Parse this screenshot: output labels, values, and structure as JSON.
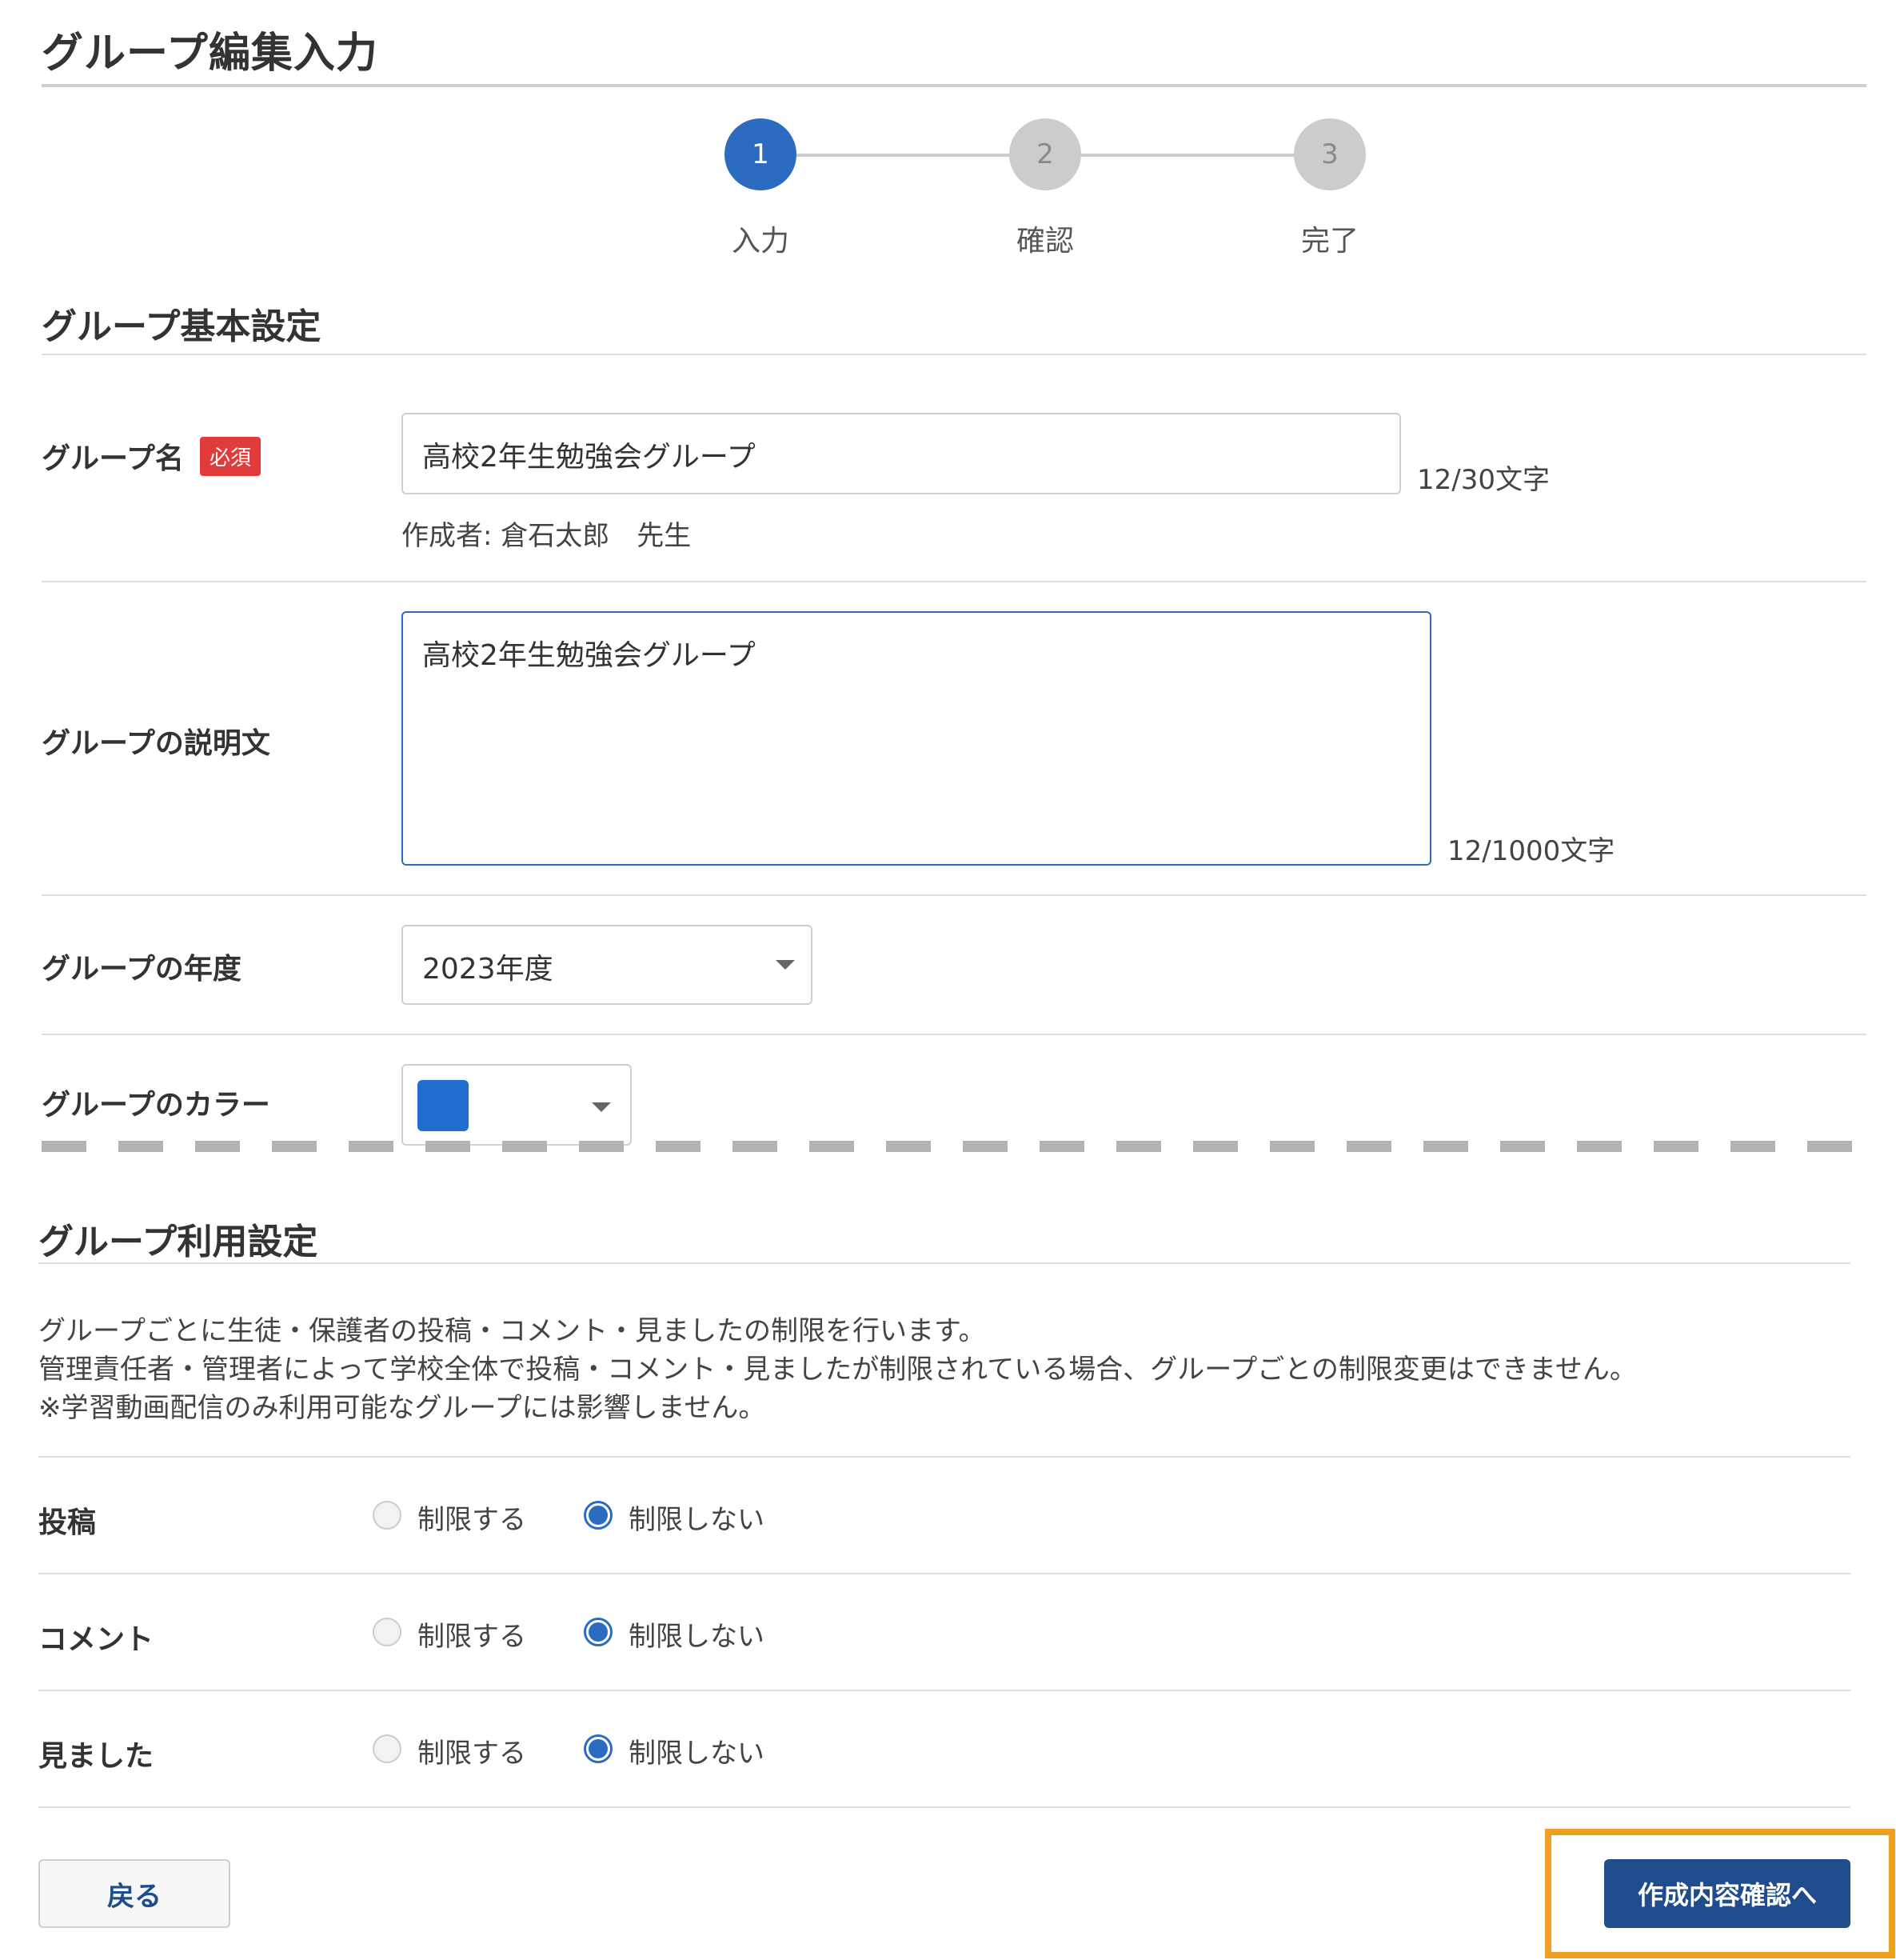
{
  "page": {
    "title": "グループ編集入力"
  },
  "stepper": {
    "steps": [
      {
        "number": "1",
        "label": "入力",
        "state": "active"
      },
      {
        "number": "2",
        "label": "確認",
        "state": "inactive"
      },
      {
        "number": "3",
        "label": "完了",
        "state": "inactive"
      }
    ]
  },
  "basic": {
    "section_title": "グループ基本設定",
    "name": {
      "label": "グループ名",
      "required_badge": "必須",
      "value": "高校2年生勉強会グループ",
      "counter": "12/30文字",
      "creator": "作成者: 倉石太郎　先生"
    },
    "description": {
      "label": "グループの説明文",
      "value": "高校2年生勉強会グループ",
      "counter": "12/1000文字"
    },
    "year": {
      "label": "グループの年度",
      "selected": "2023年度"
    },
    "color": {
      "label": "グループのカラー",
      "selected_color": "#1f6fd0"
    }
  },
  "usage": {
    "section_title": "グループ利用設定",
    "description_lines": [
      "グループごとに生徒・保護者の投稿・コメント・見ましたの制限を行います。",
      "管理責任者・管理者によって学校全体で投稿・コメント・見ましたが制限されている場合、グループごとの制限変更はできません。",
      "※学習動画配信のみ利用可能なグループには影響しません。"
    ],
    "settings": [
      {
        "label": "投稿",
        "option_restrict": "制限する",
        "option_no_restrict": "制限しない",
        "selected": "制限しない"
      },
      {
        "label": "コメント",
        "option_restrict": "制限する",
        "option_no_restrict": "制限しない",
        "selected": "制限しない"
      },
      {
        "label": "見ました",
        "option_restrict": "制限する",
        "option_no_restrict": "制限しない",
        "selected": "制限しない"
      }
    ]
  },
  "actions": {
    "back_label": "戻る",
    "next_label": "作成内容確認へ"
  },
  "colors": {
    "primary": "#2c6cc0",
    "button_dark": "#1e4c8c",
    "required": "#e23b3b",
    "highlight": "#f0a020"
  }
}
